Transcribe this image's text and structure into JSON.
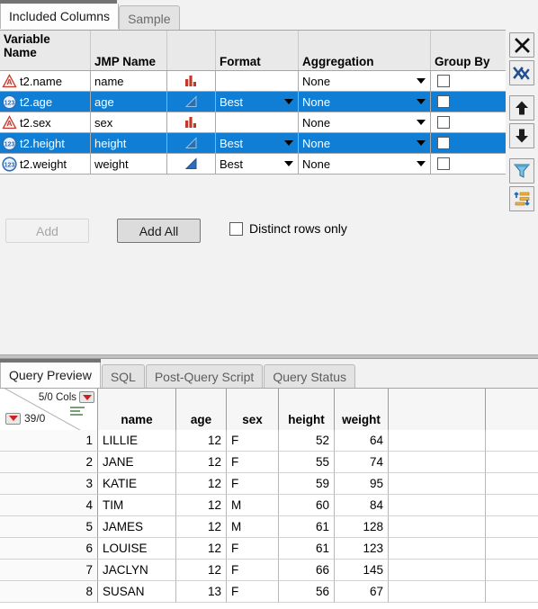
{
  "top_tabs": [
    {
      "label": "Included Columns",
      "active": true
    },
    {
      "label": "Sample",
      "active": false
    }
  ],
  "column_grid": {
    "headers": [
      "Variable\nName",
      "JMP Name",
      "",
      "Format",
      "Aggregation",
      "Group By"
    ],
    "header_variable_name_line1": "Variable",
    "header_variable_name_line2": "Name",
    "header_jmp_name": "JMP Name",
    "header_icon": "",
    "header_format": "Format",
    "header_aggregation": "Aggregation",
    "header_group_by": "Group By",
    "rows": [
      {
        "variable_name": "t2.name",
        "jmp_name": "name",
        "data_type": "character",
        "modeling_type": "nominal",
        "format": "",
        "aggregation": "None",
        "group_by": false,
        "selected": false
      },
      {
        "variable_name": "t2.age",
        "jmp_name": "age",
        "data_type": "numeric",
        "modeling_type": "continuous",
        "format": "Best",
        "aggregation": "None",
        "group_by": false,
        "selected": true
      },
      {
        "variable_name": "t2.sex",
        "jmp_name": "sex",
        "data_type": "character",
        "modeling_type": "nominal",
        "format": "",
        "aggregation": "None",
        "group_by": false,
        "selected": false
      },
      {
        "variable_name": "t2.height",
        "jmp_name": "height",
        "data_type": "numeric",
        "modeling_type": "continuous",
        "format": "Best",
        "aggregation": "None",
        "group_by": false,
        "selected": true
      },
      {
        "variable_name": "t2.weight",
        "jmp_name": "weight",
        "data_type": "numeric",
        "modeling_type": "continuous",
        "format": "Best",
        "aggregation": "None",
        "group_by": false,
        "selected": false
      }
    ]
  },
  "toolbar": [
    {
      "icon": "remove-x-icon",
      "title": "Remove"
    },
    {
      "icon": "remove-all-xx-icon",
      "title": "Remove All"
    },
    {
      "icon": "move-up-arrow-icon",
      "title": "Move Up"
    },
    {
      "icon": "move-down-arrow-icon",
      "title": "Move Down"
    },
    {
      "icon": "filter-funnel-icon",
      "title": "Filter"
    },
    {
      "icon": "sort-order-icon",
      "title": "Sort"
    }
  ],
  "actions": {
    "add_label": "Add",
    "add_enabled": false,
    "add_all_label": "Add All",
    "add_all_enabled": true,
    "distinct_rows_label": "Distinct rows only",
    "distinct_rows_checked": false
  },
  "bottom_tabs": [
    {
      "label": "Query Preview",
      "active": true
    },
    {
      "label": "SQL",
      "active": false
    },
    {
      "label": "Post-Query Script",
      "active": false
    },
    {
      "label": "Query Status",
      "active": false
    }
  ],
  "preview": {
    "cols_indicator": "5/0 Cols",
    "rows_indicator": "39/0",
    "columns": [
      "name",
      "age",
      "sex",
      "height",
      "weight"
    ],
    "rows": [
      {
        "n": "1",
        "name": "LILLIE",
        "age": "12",
        "sex": "F",
        "height": "52",
        "weight": "64"
      },
      {
        "n": "2",
        "name": "JANE",
        "age": "12",
        "sex": "F",
        "height": "55",
        "weight": "74"
      },
      {
        "n": "3",
        "name": "KATIE",
        "age": "12",
        "sex": "F",
        "height": "59",
        "weight": "95"
      },
      {
        "n": "4",
        "name": "TIM",
        "age": "12",
        "sex": "M",
        "height": "60",
        "weight": "84"
      },
      {
        "n": "5",
        "name": "JAMES",
        "age": "12",
        "sex": "M",
        "height": "61",
        "weight": "128"
      },
      {
        "n": "6",
        "name": "LOUISE",
        "age": "12",
        "sex": "F",
        "height": "61",
        "weight": "123"
      },
      {
        "n": "7",
        "name": "JACLYN",
        "age": "12",
        "sex": "F",
        "height": "66",
        "weight": "145"
      },
      {
        "n": "8",
        "name": "SUSAN",
        "age": "13",
        "sex": "F",
        "height": "56",
        "weight": "67"
      }
    ]
  },
  "colors": {
    "selection_blue": "#0f7ed4",
    "nominal_red": "#c0392b",
    "continuous_blue": "#2a6fba",
    "red_triangle": "#cf2020"
  }
}
